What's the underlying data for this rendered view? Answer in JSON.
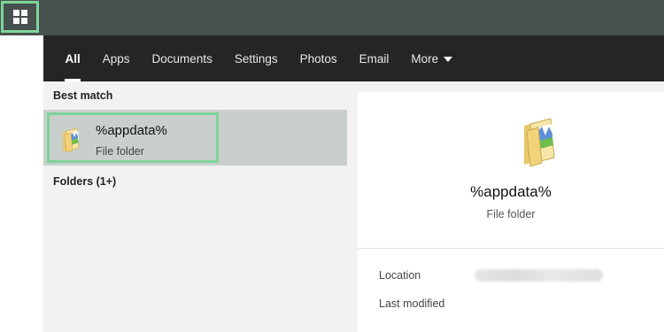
{
  "taskbar": {
    "start_icon": "windows-logo-icon"
  },
  "search": {
    "tabs": [
      {
        "label": "All",
        "active": true
      },
      {
        "label": "Apps"
      },
      {
        "label": "Documents"
      },
      {
        "label": "Settings"
      },
      {
        "label": "Photos"
      },
      {
        "label": "Email"
      },
      {
        "label": "More",
        "icon": "caret-down-icon"
      }
    ],
    "best_match_label": "Best match",
    "best_match": {
      "title": "%appdata%",
      "subtitle": "File folder",
      "icon": "folder-icon"
    },
    "folders_label": "Folders (1+)"
  },
  "preview": {
    "title": "%appdata%",
    "subtitle": "File folder",
    "icon": "folder-icon",
    "location_label": "Location",
    "last_modified_label": "Last modified"
  },
  "colors": {
    "highlight_outline": "#7fd49a",
    "taskbar": "#475250",
    "tabbar": "#252525",
    "selected_result": "#c8cfcc"
  }
}
